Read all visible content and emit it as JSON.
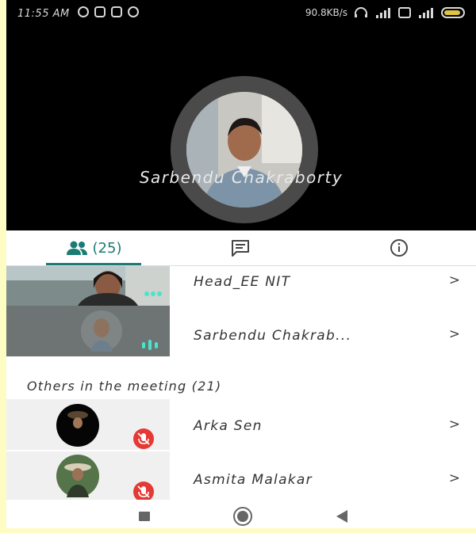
{
  "status_bar": {
    "time": "11:55 AM",
    "network_speed": "90.8KB/s",
    "battery_level": "64",
    "icons": [
      "whatsapp-icon",
      "youtube-icon",
      "app-icon",
      "chat-bubble-icon",
      "headphones-icon",
      "signal-icon",
      "volte-icon",
      "signal-icon",
      "battery-icon"
    ]
  },
  "speaker": {
    "name": "Sarbendu Chakraborty"
  },
  "tabs": {
    "people_count": "(25)",
    "people_icon": "people-icon",
    "chat_icon": "chat-icon",
    "info_icon": "info-icon",
    "accent_color": "#1a7b75"
  },
  "participants": [
    {
      "name": "Head_EE NIT",
      "state": "speaking"
    },
    {
      "name": "Sarbendu Chakrab...",
      "state": "speaking"
    }
  ],
  "others": {
    "title": "Others in the meeting (21)",
    "items": [
      {
        "name": "Arka Sen",
        "muted": true
      },
      {
        "name": "Asmita Malakar",
        "muted": true
      }
    ]
  },
  "chevron": ">",
  "mute_color": "#e53935",
  "nav": [
    "recents-icon",
    "home-icon",
    "back-icon"
  ]
}
